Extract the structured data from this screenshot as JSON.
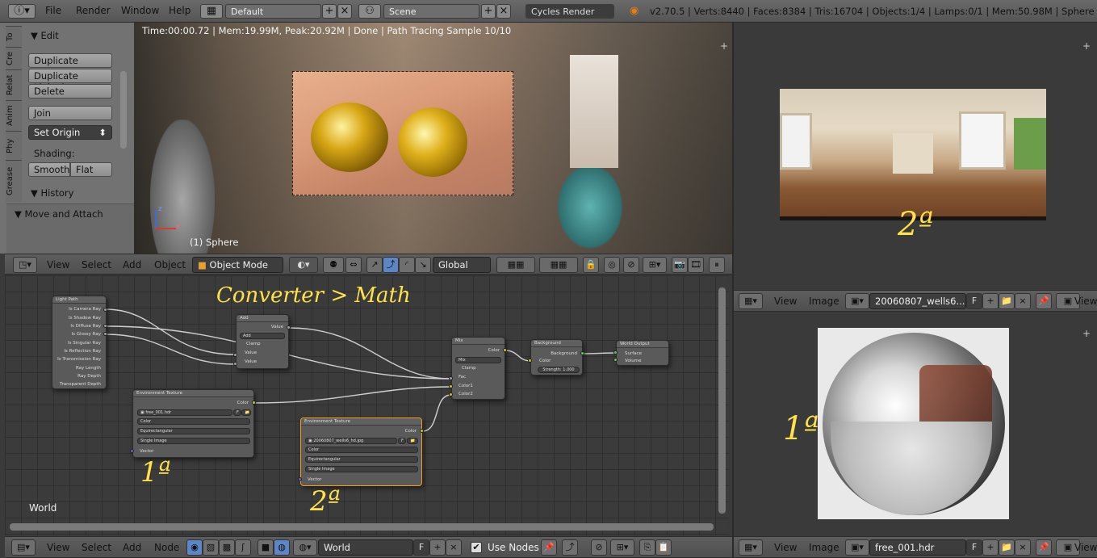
{
  "topbar": {
    "menus": [
      "File",
      "Render",
      "Window",
      "Help"
    ],
    "screen_layout": "Default",
    "scene": "Scene",
    "render_engine": "Cycles Render",
    "stats": "v2.70.5 | Verts:8440 | Faces:8384 | Tris:16704 | Objects:1/4 | Lamps:0/1 | Mem:50.98M | Sphere"
  },
  "tool_panel": {
    "tabs": [
      "To",
      "Cre",
      "Relat",
      "Anim",
      "Phy",
      "Grease"
    ],
    "edit_header": "Edit",
    "buttons": [
      "Duplicate",
      "Duplicate Linked",
      "Delete",
      "Join"
    ],
    "set_origin": "Set Origin",
    "shading_label": "Shading:",
    "smooth": "Smooth",
    "flat": "Flat",
    "history": "History",
    "move_attach": "Move and Attach"
  },
  "viewport": {
    "status": "Time:00:00.72 | Mem:19.99M, Peak:20.92M | Done | Path Tracing Sample 10/10",
    "object_label": "(1) Sphere",
    "axis_z": "z",
    "axis_x": "x"
  },
  "viewport_header": {
    "menus": [
      "View",
      "Select",
      "Add",
      "Object"
    ],
    "mode": "Object Mode",
    "orientation": "Global"
  },
  "node_editor": {
    "annotation_title": "Converter > Math",
    "world_label": "World",
    "annotation_1": "1ª",
    "annotation_2": "2ª",
    "light_path": {
      "title": "Light Path",
      "outputs": [
        "Is Camera Ray",
        "Is Shadow Ray",
        "Is Diffuse Ray",
        "Is Glossy Ray",
        "Is Singular Ray",
        "Is Reflection Ray",
        "Is Transmission Ray",
        "Ray Length",
        "Ray Depth",
        "Transparent Depth"
      ]
    },
    "add_node": {
      "title": "Add",
      "value_out": "Value",
      "op": "Add",
      "clamp": "Clamp",
      "in1": "Value",
      "in2": "Value"
    },
    "mix_node": {
      "title": "Mix",
      "color_out": "Color",
      "op": "Mix",
      "clamp": "Clamp",
      "fac": "Fac",
      "c1": "Color1",
      "c2": "Color2"
    },
    "background_node": {
      "title": "Background",
      "out": "Background",
      "color": "Color",
      "strength": "Strength:",
      "strength_val": "1.000"
    },
    "world_output": {
      "title": "World Output",
      "surface": "Surface",
      "volume": "Volume"
    },
    "env1": {
      "title": "Environment Texture",
      "color_out": "Color",
      "file": "free_001.hdr",
      "f": "F",
      "color_mode": "Color",
      "projection": "Equirectangular",
      "source": "Single Image",
      "vector": "Vector"
    },
    "env2": {
      "title": "Environment Texture",
      "color_out": "Color",
      "file": "20060807_wells6_hd.jpg",
      "f": "F",
      "color_mode": "Color",
      "projection": "Equirectangular",
      "source": "Single Image",
      "vector": "Vector"
    }
  },
  "node_header": {
    "menus": [
      "View",
      "Select",
      "Add",
      "Node"
    ],
    "world": "World",
    "f": "F",
    "use_nodes": "Use Nodes"
  },
  "image_top": {
    "annotation": "2ª",
    "menus": [
      "View",
      "Image"
    ],
    "file": "20060807_wells6...",
    "f": "F",
    "view": "View"
  },
  "image_bottom": {
    "annotation": "1ª",
    "menus": [
      "View",
      "Image"
    ],
    "file": "free_001.hdr",
    "f": "F",
    "view": "View"
  },
  "colors": {
    "annotation": "#ffe24a",
    "selected_node": "#f39c1c",
    "socket_color": "#c7c729",
    "socket_value": "#a1a1a1",
    "socket_vector": "#6363c7"
  }
}
